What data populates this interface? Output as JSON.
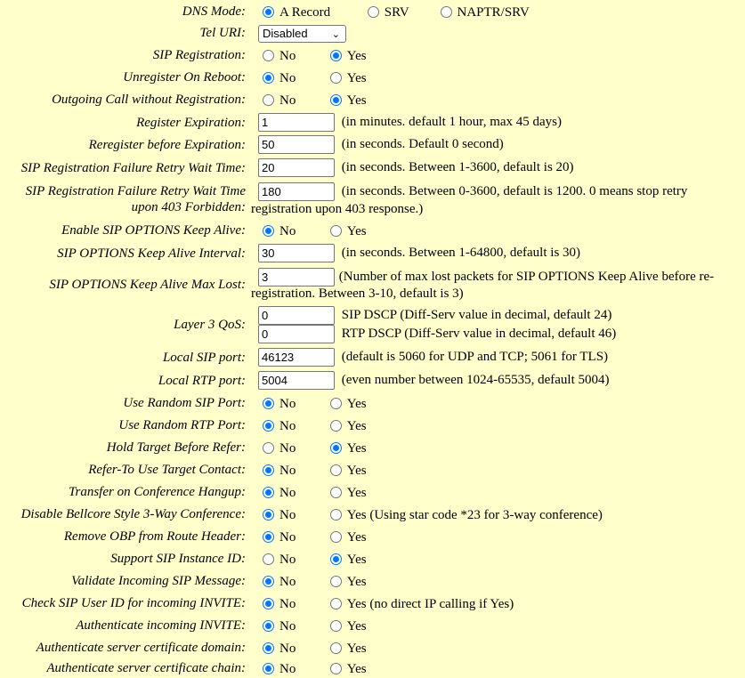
{
  "dns_mode": {
    "label": "DNS Mode:",
    "options": [
      "A Record",
      "SRV",
      "NAPTR/SRV"
    ],
    "selected": 0
  },
  "tel_uri": {
    "label": "Tel URI:",
    "value": "Disabled",
    "chevron": "⌄"
  },
  "sip_registration": {
    "label": "SIP Registration:",
    "no": "No",
    "yes": "Yes",
    "selected": "yes"
  },
  "unregister_on_reboot": {
    "label": "Unregister On Reboot:",
    "no": "No",
    "yes": "Yes",
    "selected": "no"
  },
  "outgoing_without_registration": {
    "label": "Outgoing Call without Registration:",
    "no": "No",
    "yes": "Yes",
    "selected": "yes"
  },
  "register_expiration": {
    "label": "Register Expiration:",
    "value": "1",
    "note": "(in minutes. default 1 hour, max 45 days)"
  },
  "reregister_before_expiration": {
    "label": "Reregister before Expiration:",
    "value": "50",
    "note": "(in seconds. Default 0 second)"
  },
  "reg_failure_retry": {
    "label": "SIP Registration Failure Retry Wait Time:",
    "value": "20",
    "note": "(in seconds. Between 1-3600, default is 20)"
  },
  "reg_failure_retry_403": {
    "label_line1": "SIP Registration Failure Retry Wait Time",
    "label_line2": "upon 403 Forbidden:",
    "value": "180",
    "note_line1": "(in seconds. Between 0-3600, default is 1200. 0 means stop retry",
    "note_line2": "registration upon 403 response.)"
  },
  "enable_options_keepalive": {
    "label": "Enable SIP OPTIONS Keep Alive:",
    "no": "No",
    "yes": "Yes",
    "selected": "no"
  },
  "options_keepalive_interval": {
    "label": "SIP OPTIONS Keep Alive Interval:",
    "value": "30",
    "note": "(in seconds. Between 1-64800, default is 30)"
  },
  "options_keepalive_max_lost": {
    "label": "SIP OPTIONS Keep Alive Max Lost:",
    "value": "3",
    "note_line1": "(Number of max lost packets for SIP OPTIONS Keep Alive before re-",
    "note_line2": "registration. Between 3-10, default is 3)"
  },
  "layer3_qos": {
    "label": "Layer 3 QoS:",
    "sip_value": "0",
    "sip_note": "SIP DSCP (Diff-Serv value in decimal, default 24)",
    "rtp_value": "0",
    "rtp_note": "RTP DSCP (Diff-Serv value in decimal, default 46)"
  },
  "local_sip_port": {
    "label": "Local SIP port:",
    "value": "46123",
    "note": "(default is 5060 for UDP and TCP; 5061 for TLS)"
  },
  "local_rtp_port": {
    "label": "Local RTP port:",
    "value": "5004",
    "note": "(even number between 1024-65535, default 5004)"
  },
  "use_random_sip_port": {
    "label": "Use Random SIP Port:",
    "no": "No",
    "yes": "Yes",
    "selected": "no"
  },
  "use_random_rtp_port": {
    "label": "Use Random RTP Port:",
    "no": "No",
    "yes": "Yes",
    "selected": "no"
  },
  "hold_target_before_refer": {
    "label": "Hold Target Before Refer:",
    "no": "No",
    "yes": "Yes",
    "selected": "yes"
  },
  "refer_to_use_target_contact": {
    "label": "Refer-To Use Target Contact:",
    "no": "No",
    "yes": "Yes",
    "selected": "no"
  },
  "transfer_on_conference_hangup": {
    "label": "Transfer on Conference Hangup:",
    "no": "No",
    "yes": "Yes",
    "selected": "no"
  },
  "disable_bellcore_3way": {
    "label": "Disable Bellcore Style 3-Way Conference:",
    "no": "No",
    "yes": "Yes (Using star code *23 for 3-way conference)",
    "selected": "no"
  },
  "remove_obp": {
    "label": "Remove OBP from Route Header:",
    "no": "No",
    "yes": "Yes",
    "selected": "no"
  },
  "support_sip_instance_id": {
    "label": "Support SIP Instance ID:",
    "no": "No",
    "yes": "Yes",
    "selected": "yes"
  },
  "validate_incoming_sip": {
    "label": "Validate Incoming SIP Message:",
    "no": "No",
    "yes": "Yes",
    "selected": "no"
  },
  "check_sip_user_id": {
    "label": "Check SIP User ID for incoming INVITE:",
    "no": "No",
    "yes": "Yes (no direct IP calling if Yes)",
    "selected": "no"
  },
  "authenticate_incoming_invite": {
    "label": "Authenticate incoming INVITE:",
    "no": "No",
    "yes": "Yes",
    "selected": "no"
  },
  "auth_server_cert_domain": {
    "label": "Authenticate server certificate domain:",
    "no": "No",
    "yes": "Yes",
    "selected": "no"
  },
  "auth_server_cert_chain": {
    "label": "Authenticate server certificate chain:",
    "no": "No",
    "yes": "Yes",
    "selected": "no"
  }
}
